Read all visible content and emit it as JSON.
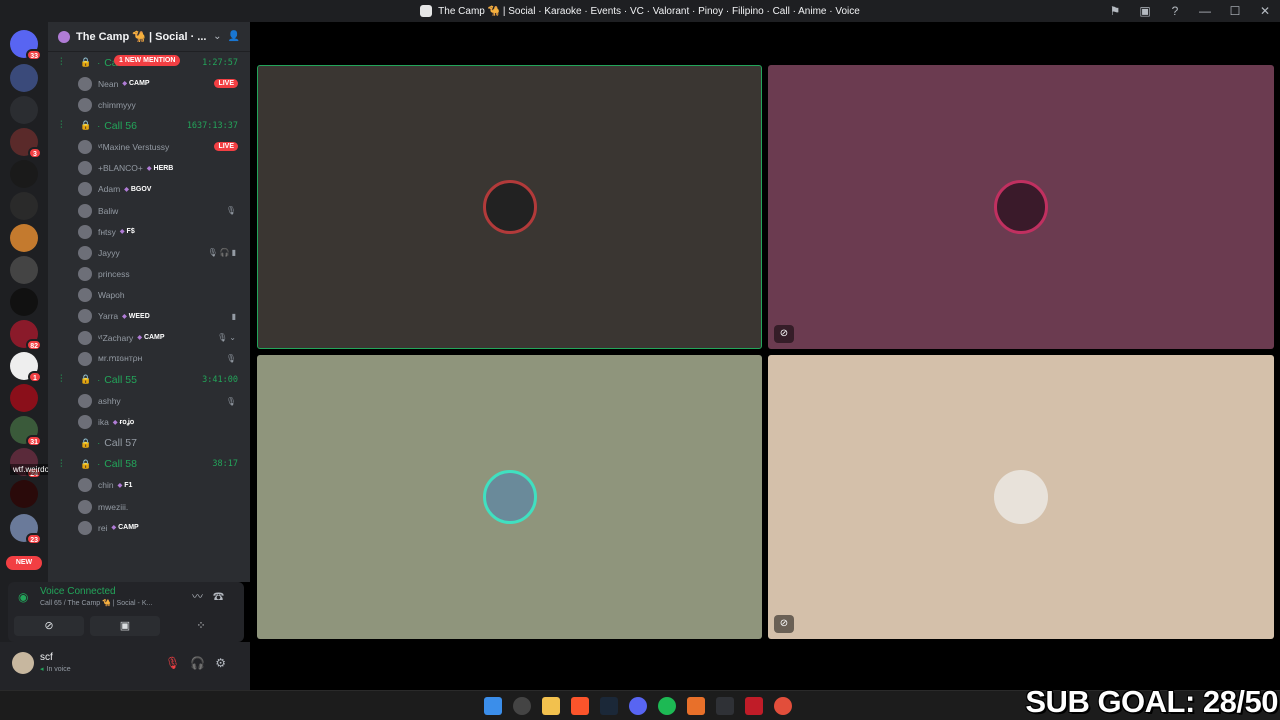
{
  "window": {
    "title": "The Camp 🐪 | Social · Karaoke · Events · VC · Valorant · Pinoy · Filipino · Call · Anime · Voice",
    "controls": [
      "⚑",
      "▣",
      "?",
      "—",
      "☐",
      "✕"
    ]
  },
  "servers": {
    "home_badge": "33",
    "badges": [
      "3",
      "82",
      "1",
      "31",
      "24",
      "23"
    ],
    "new_label": "NEW",
    "notice": "wtf.weirdo."
  },
  "sidebar": {
    "server_name": "The Camp 🐪 | Social · ...",
    "new_mention": "1 NEW MENTION",
    "channels": [
      {
        "name": "Ca",
        "timer": "1:27:57",
        "users": [
          {
            "name": "Nean",
            "tag": "CAMP",
            "live": "LIVE"
          },
          {
            "name": "chimmyyy",
            "tag": ""
          }
        ]
      },
      {
        "name": "Call 56",
        "timer": "1637:13:37",
        "users": [
          {
            "name": "ᵛᵗMaxine Verstussy",
            "tag": "",
            "live": "LIVE"
          },
          {
            "name": "+BLANCO+",
            "tag": "HERB"
          },
          {
            "name": "Adam",
            "tag": "BGOV"
          },
          {
            "name": "Baliw",
            "tag": "",
            "icons": "🎙"
          },
          {
            "name": "fнtsy",
            "tag": "F$"
          },
          {
            "name": "Jayyy",
            "tag": "",
            "icons": "🎙🎧▮"
          },
          {
            "name": "princess",
            "tag": ""
          },
          {
            "name": "Wapoh",
            "tag": ""
          },
          {
            "name": "Yarra",
            "tag": "WEED",
            "icons": "▮"
          },
          {
            "name": "ᵛᵗZachary",
            "tag": "CAMP",
            "icons": "🎙⌄"
          },
          {
            "name": "мr.ꭑɪɢнтρн",
            "tag": "",
            "icons": "🎙"
          }
        ]
      },
      {
        "name": "Call 55",
        "timer": "3:41:00",
        "users": [
          {
            "name": "ashhy",
            "tag": "",
            "icons": "🎙"
          },
          {
            "name": "ika",
            "tag": "ғօʝօ"
          }
        ]
      },
      {
        "name": "Call 57",
        "timer": "",
        "users": []
      },
      {
        "name": "Call 58",
        "timer": "38:17",
        "users": [
          {
            "name": "chin",
            "tag": "F1"
          },
          {
            "name": "mweziii.",
            "tag": ""
          },
          {
            "name": "rei",
            "tag": "CAMP"
          }
        ]
      }
    ]
  },
  "voice": {
    "status": "Voice Connected",
    "location": "Call 65 / The Camp 🐪 | Social - K..."
  },
  "user": {
    "name": "scf",
    "status": "In voice"
  },
  "colors": {
    "tile1": "#3a3632",
    "tile2": "#6b3b50",
    "tile3": "#8f957c",
    "tile4": "#d4c0aa",
    "accent_green": "#23a55a",
    "danger_red": "#f23f43"
  },
  "overlay": {
    "sub_goal": "SUB GOAL: 28/50"
  }
}
